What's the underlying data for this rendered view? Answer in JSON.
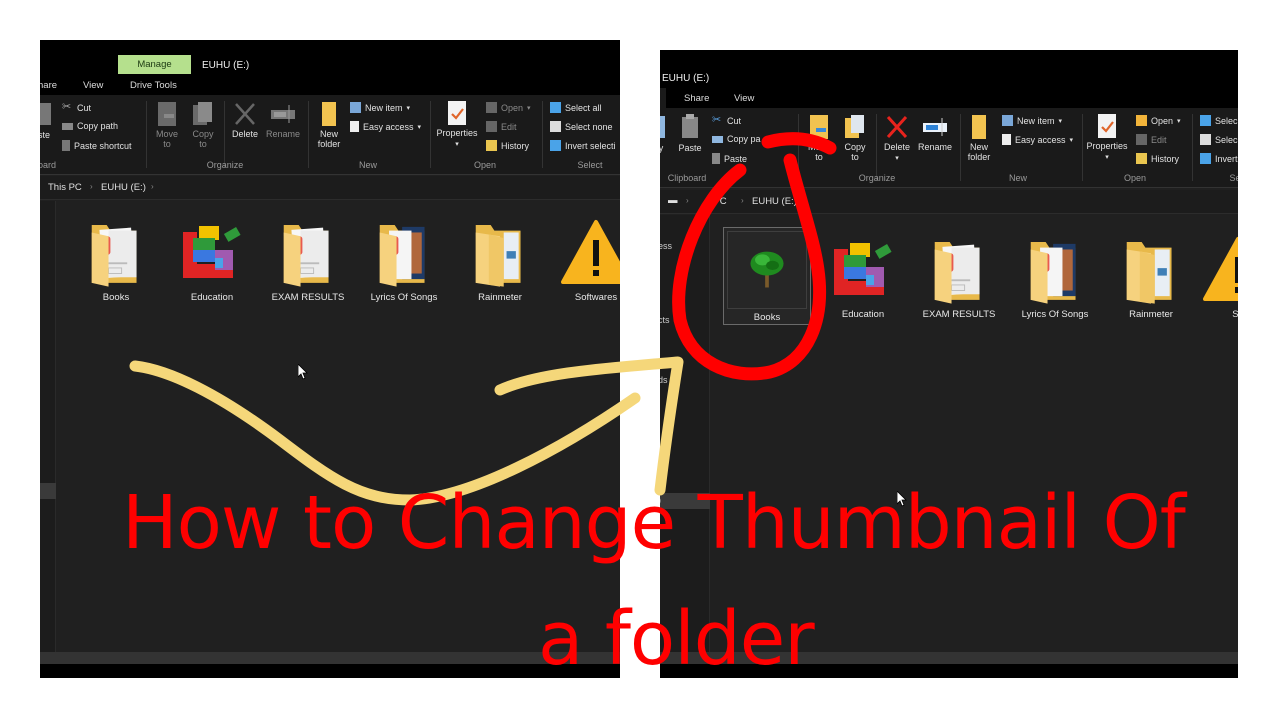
{
  "left_window": {
    "title": "EUHU (E:)",
    "context_tab": "Manage",
    "context_subtab": "Drive Tools",
    "tabs": [
      "hare",
      "View"
    ],
    "ribbon": {
      "clipboard": {
        "paste_partial": "ste",
        "cut": "Cut",
        "copy_path": "Copy path",
        "paste_shortcut": "Paste shortcut",
        "group": "oard"
      },
      "organize": {
        "move_to": [
          "Move",
          "to"
        ],
        "copy_to": [
          "Copy",
          "to"
        ],
        "delete": "Delete",
        "rename": "Rename",
        "group": "Organize"
      },
      "new": {
        "new_folder": [
          "New",
          "folder"
        ],
        "new_item": "New item",
        "easy_access": "Easy access",
        "group": "New"
      },
      "open": {
        "properties": "Properties",
        "open": "Open",
        "edit": "Edit",
        "history": "History",
        "group": "Open"
      },
      "select": {
        "select_all": "Select all",
        "select_none": "Select none",
        "invert_selection": "Invert selecti",
        "group": "Select"
      }
    },
    "breadcrumb": [
      "This PC",
      "EUHU (E:)"
    ],
    "items": [
      {
        "name": "Books",
        "icon": "folder-docs-icon"
      },
      {
        "name": "Education",
        "icon": "education-blocks-icon"
      },
      {
        "name": "EXAM RESULTS",
        "icon": "folder-docs-icon"
      },
      {
        "name": "Lyrics Of Songs",
        "icon": "folder-photo-icon"
      },
      {
        "name": "Rainmeter",
        "icon": "folder-plain-icon"
      },
      {
        "name": "Softwares",
        "icon": "warning-icon"
      }
    ]
  },
  "right_window": {
    "title": "EUHU (E:)",
    "tabs": [
      "Share",
      "View"
    ],
    "ribbon": {
      "clipboard": {
        "copy_partial": "y",
        "paste": "Paste",
        "cut": "Cut",
        "copy_path": "Copy pa",
        "paste_shortcut": "Paste",
        "group": "Clipboard"
      },
      "organize": {
        "move_to": [
          "Move",
          "to"
        ],
        "copy_to": [
          "Copy",
          "to"
        ],
        "delete": "Delete",
        "rename": "Rename",
        "group": "Organize"
      },
      "new": {
        "new_folder": [
          "New",
          "folder"
        ],
        "new_item": "New item",
        "easy_access": "Easy access",
        "group": "New"
      },
      "open": {
        "properties": "Properties",
        "open": "Open",
        "edit": "Edit",
        "history": "History",
        "group": "Open"
      },
      "select": {
        "select_all": "Selec",
        "select_none": "Selec",
        "invert_selection": "Invert",
        "group": "Se"
      }
    },
    "breadcrumb": [
      "s PC",
      "EUHU (E:)"
    ],
    "nav": [
      "ess",
      "cts",
      "ds",
      ")"
    ],
    "items": [
      {
        "name": "Books",
        "icon": "tree-thumbnail-icon",
        "selected": true
      },
      {
        "name": "Education",
        "icon": "education-blocks-icon"
      },
      {
        "name": "EXAM RESULTS",
        "icon": "folder-docs-icon"
      },
      {
        "name": "Lyrics Of Songs",
        "icon": "folder-photo-icon"
      },
      {
        "name": "Rainmeter",
        "icon": "folder-plain-icon"
      },
      {
        "name": "So",
        "icon": "warning-icon"
      }
    ]
  },
  "headline": {
    "line1": "How to Change Thumbnail Of",
    "line2": "a folder"
  },
  "colors": {
    "headline": "#ff0000",
    "annotation_arrow": "#f5d77a",
    "annotation_circle": "#ff0000",
    "manage_tab": "#b5e08d",
    "window_bg": "#202020"
  }
}
